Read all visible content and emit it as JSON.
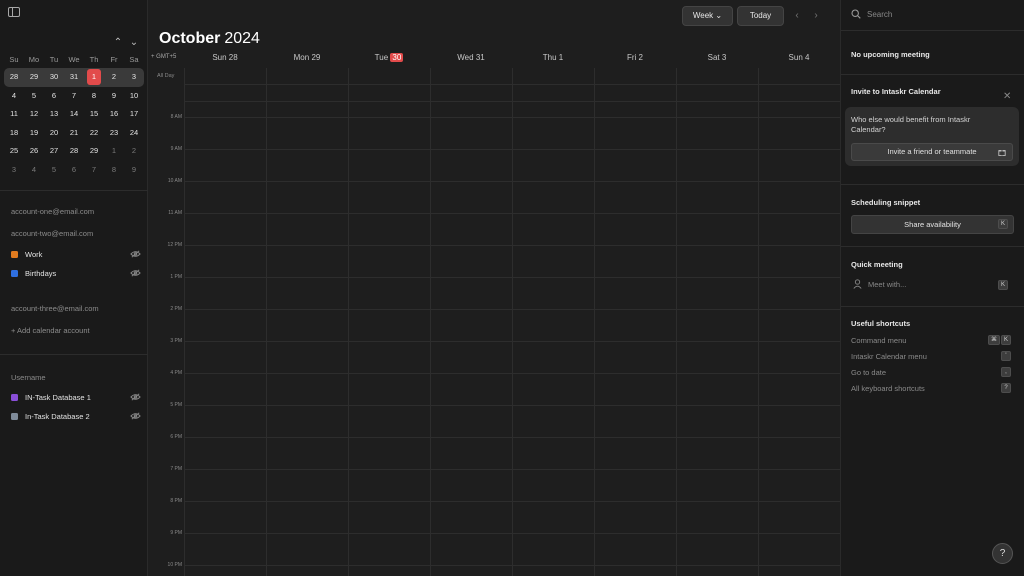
{
  "sidebar": {
    "dow": [
      "Su",
      "Mo",
      "Tu",
      "We",
      "Th",
      "Fr",
      "Sa"
    ],
    "weeks": [
      [
        {
          "d": "28",
          "m": false
        },
        {
          "d": "29",
          "m": false
        },
        {
          "d": "30",
          "m": false
        },
        {
          "d": "31",
          "m": false
        },
        {
          "d": "1",
          "m": false,
          "today": true
        },
        {
          "d": "2",
          "m": false
        },
        {
          "d": "3",
          "m": false
        }
      ],
      [
        {
          "d": "4"
        },
        {
          "d": "5"
        },
        {
          "d": "6"
        },
        {
          "d": "7"
        },
        {
          "d": "8"
        },
        {
          "d": "9"
        },
        {
          "d": "10"
        }
      ],
      [
        {
          "d": "11"
        },
        {
          "d": "12"
        },
        {
          "d": "13"
        },
        {
          "d": "14"
        },
        {
          "d": "15"
        },
        {
          "d": "16"
        },
        {
          "d": "17"
        }
      ],
      [
        {
          "d": "18"
        },
        {
          "d": "19"
        },
        {
          "d": "20"
        },
        {
          "d": "21"
        },
        {
          "d": "22"
        },
        {
          "d": "23"
        },
        {
          "d": "24"
        }
      ],
      [
        {
          "d": "25"
        },
        {
          "d": "26"
        },
        {
          "d": "27"
        },
        {
          "d": "28"
        },
        {
          "d": "29"
        },
        {
          "d": "1",
          "m": true
        },
        {
          "d": "2",
          "m": true
        }
      ],
      [
        {
          "d": "3",
          "m": true
        },
        {
          "d": "4",
          "m": true
        },
        {
          "d": "5",
          "m": true
        },
        {
          "d": "6",
          "m": true
        },
        {
          "d": "7",
          "m": true
        },
        {
          "d": "8",
          "m": true
        },
        {
          "d": "9",
          "m": true
        }
      ]
    ],
    "account_one": "account-one@email.com",
    "account_two": "account-two@email.com",
    "calendars": [
      {
        "label": "Work",
        "color": "#e07b1f"
      },
      {
        "label": "Birthdays",
        "color": "#2f6fe0"
      }
    ],
    "account_three": "account-three@email.com",
    "add_account": "+ Add calendar account",
    "username": "Username",
    "databases": [
      {
        "label": "IN-Task Database 1",
        "color": "#8a4fd8"
      },
      {
        "label": "In-Task Database 2",
        "color": "#7f8b99"
      }
    ]
  },
  "header": {
    "month": "October",
    "year": "2024",
    "view": "Week",
    "today": "Today",
    "timezone": "+ GMT+5",
    "allday": "All Day",
    "days": [
      {
        "name": "Sun",
        "num": "28"
      },
      {
        "name": "Mon",
        "num": "29"
      },
      {
        "name": "Tue",
        "num": "30",
        "today": true
      },
      {
        "name": "Wed",
        "num": "31"
      },
      {
        "name": "Thu",
        "num": "1"
      },
      {
        "name": "Fri",
        "num": "2"
      },
      {
        "name": "Sat",
        "num": "3"
      },
      {
        "name": "Sun",
        "num": "4"
      }
    ],
    "hours": [
      "8 AM",
      "9 AM",
      "10 AM",
      "11 AM",
      "12 PM",
      "1 PM",
      "2 PM",
      "3 PM",
      "4 PM",
      "5 PM",
      "6 PM",
      "7 PM",
      "8 PM",
      "9 PM",
      "10 PM"
    ]
  },
  "right": {
    "search_placeholder": "Search",
    "no_meeting": "No upcoming meeting",
    "invite_title": "Invite to Intaskr Calendar",
    "invite_question": "Who else would benefit from Intaskr Calendar?",
    "invite_button": "Invite a friend or teammate",
    "scheduling_title": "Scheduling snippet",
    "share_button": "Share availability",
    "share_key": "K",
    "quick_title": "Quick meeting",
    "meet_placeholder": "Meet with...",
    "meet_key": "K",
    "shortcuts_title": "Useful shortcuts",
    "shortcuts": [
      {
        "label": "Command menu",
        "key": "K",
        "gift": true
      },
      {
        "label": "Intaskr Calendar menu",
        "key": "'"
      },
      {
        "label": "Go to date",
        "key": ","
      },
      {
        "label": "All keyboard shortcuts",
        "key": "?"
      }
    ],
    "help": "?"
  }
}
